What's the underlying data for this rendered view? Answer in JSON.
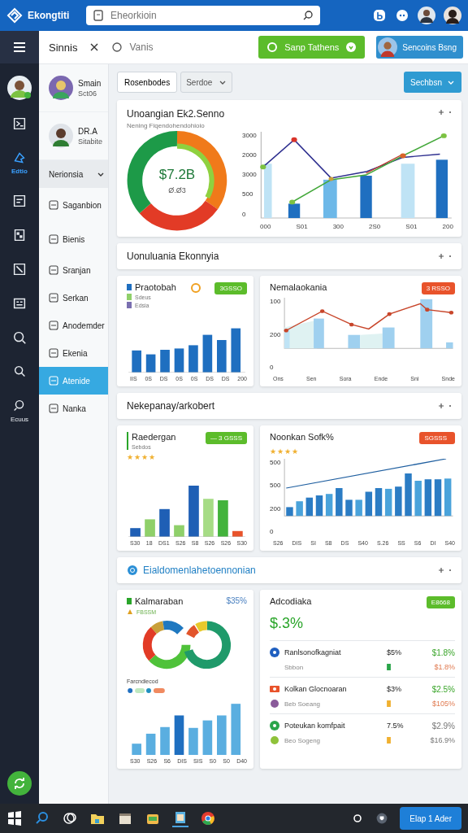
{
  "topbar": {
    "logo": "Ekongtiti",
    "search_placeholder": "Eheorkioin"
  },
  "rail": {
    "items": [
      {
        "selected": false
      },
      {
        "label": "Edtio",
        "selected": true
      },
      {
        "selected": false
      },
      {
        "selected": false
      },
      {
        "selected": false
      },
      {
        "selected": false
      },
      {
        "selected": false
      },
      {
        "selected": false
      },
      {
        "label": "Ecuus",
        "selected": false
      }
    ]
  },
  "header": {
    "title": "Sinnis",
    "search_placeholder": "Vanis",
    "primary_button": "Sanp Tathens",
    "profile_button": "Sencoins Bsng"
  },
  "sidebar": {
    "profiles": [
      {
        "name": "Smain",
        "subtitle": "Sct06"
      },
      {
        "name": "DR.A",
        "subtitle": "Sitabite"
      }
    ],
    "items": [
      {
        "label": "Nerionsia",
        "kind": "group",
        "expanded": true,
        "selected": false
      },
      {
        "label": "Saganbion",
        "kind": "link",
        "selected": false
      },
      {
        "label": "Bienis",
        "kind": "link",
        "selected": false
      },
      {
        "label": "Sranjan",
        "kind": "link",
        "selected": false
      },
      {
        "label": "Serkan",
        "kind": "link",
        "selected": false
      },
      {
        "label": "Anodemder",
        "kind": "link",
        "selected": false
      },
      {
        "label": "Ekenia",
        "kind": "link",
        "selected": false
      },
      {
        "label": "Atenide",
        "kind": "link",
        "selected": true
      },
      {
        "label": "Nanka",
        "kind": "link",
        "selected": false
      }
    ]
  },
  "toolbar": {
    "button": "Rosenbodes",
    "select": "Serdoe",
    "action": "Sechbsn"
  },
  "overview": {
    "title": "Unoangian Ek2.Senno",
    "subtitle": "Nening Fiqendohendohioio",
    "donut_value": "$7.2B",
    "donut_caption": "Ø.Ø3",
    "y_labels": [
      "3000",
      "2000",
      "3000",
      "500",
      "0"
    ],
    "x_labels": [
      "000",
      "S01",
      "300",
      "2S0",
      "S01",
      "200"
    ]
  },
  "section_1": {
    "title": "Uonuluania Ekonnyia",
    "bar_card": {
      "title": "Praotobah",
      "legend": [
        "Sdeus",
        "Edsia"
      ],
      "badge": "3GSSO",
      "x_labels": [
        "IIS",
        "0S",
        "DS",
        "0S",
        "0S",
        "DS",
        "DS",
        "200"
      ]
    },
    "line_card": {
      "title": "Nemalaokania",
      "badge": "3 RSSO",
      "y_labels": [
        "100",
        "200",
        "0"
      ],
      "x_labels": [
        "Ons",
        "Sen",
        "Sora",
        "Ende",
        "Sni",
        "Snde"
      ]
    }
  },
  "section_2": {
    "title": "Nekepanay/arkobert",
    "bar_card": {
      "title": "Raedergan",
      "subtitle": "Sebdos",
      "badge": "— 3 GSSS",
      "stars": 4,
      "x_labels": [
        "S30",
        "18",
        "DS1",
        "S26",
        "S8",
        "S26",
        "S26",
        "S30"
      ]
    },
    "trend_card": {
      "title": "Noonkan Sofk%",
      "badge": "SGSSS",
      "stars": 4,
      "y_labels": [
        "500",
        "500",
        "200",
        "0"
      ],
      "x_labels": [
        "S26",
        "DIS",
        "SI",
        "S8",
        "DS",
        "S40",
        "S.26",
        "SS",
        "S6",
        "DI",
        "S40"
      ]
    }
  },
  "section_3": {
    "title": "Eialdomenlahetoennonian",
    "donut_card": {
      "title": "Kalmaraban",
      "value": "$35%",
      "subtitle": "FBSSM",
      "legend_title": "Farcndiecod",
      "x_labels": [
        "S30",
        "S26",
        "S6",
        "DIS",
        "SIS",
        "S0",
        "S0",
        "D40"
      ]
    },
    "table_card": {
      "title": "Adcodiaka",
      "badge": "E8668",
      "value": "$.3%",
      "rows": [
        {
          "name": "Ranlsonofkagniat",
          "sub": "Sbbon",
          "share": "$5%",
          "change": "$1.8%",
          "prior": "$1.8%"
        },
        {
          "name": "Kolkan Glocnoaran",
          "sub": "Beb Soeang",
          "share": "$3%",
          "change": "$2.5%",
          "prior": "$105%"
        },
        {
          "name": "Poteukan komfpait",
          "sub": "Beo Sogeng",
          "share": "7.5%",
          "change": "$2.9%",
          "prior": "$16.9%"
        }
      ]
    }
  },
  "taskbar": {
    "button": "Elap 1 Ader"
  }
}
